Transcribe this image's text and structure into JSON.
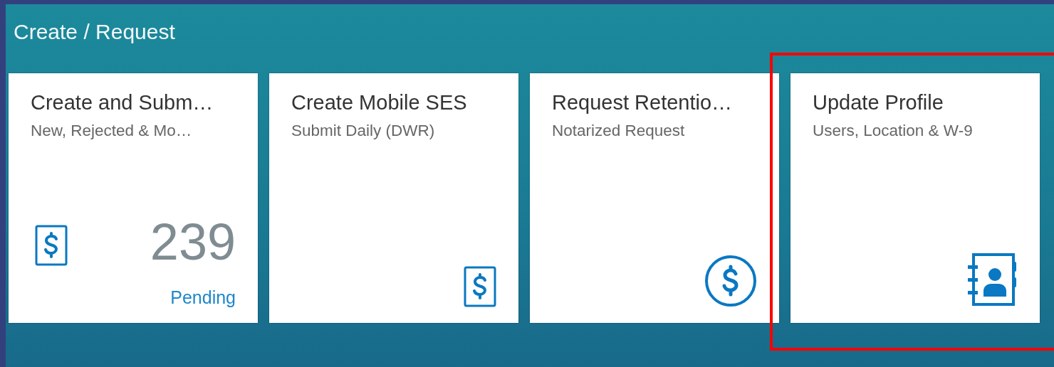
{
  "group": {
    "title": "Create / Request"
  },
  "tiles": [
    {
      "title": "Create and Subm…",
      "subtitle": "New, Rejected & Mo…",
      "kind": "document-dollar",
      "count": "239",
      "footer": "Pending",
      "highlighted": false
    },
    {
      "title": "Create Mobile SES",
      "subtitle": "Submit Daily (DWR)",
      "kind": "document-dollar",
      "highlighted": false
    },
    {
      "title": "Request Retentio…",
      "subtitle": "Notarized Request",
      "kind": "circle-dollar",
      "highlighted": false
    },
    {
      "title": "Update Profile",
      "subtitle": "Users, Location & W-9",
      "kind": "address-book",
      "highlighted": true
    }
  ]
}
